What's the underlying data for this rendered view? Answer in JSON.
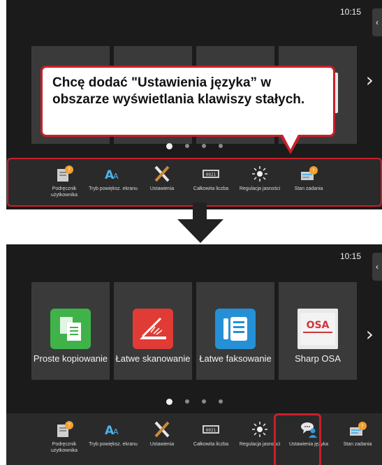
{
  "clock": "10:15",
  "callout_text": "Chcę dodać \"Ustawienia języka” w obszarze wyświetlania klawiszy stałych.",
  "tiles": [
    {
      "icon": "copy-icon",
      "label": "Proste kopiowanie",
      "color": "#3fb349"
    },
    {
      "icon": "scan-icon",
      "label": "Łatwe skanowanie",
      "color": "#e03b35"
    },
    {
      "icon": "fax-icon",
      "label": "Łatwe faksowanie",
      "color": "#2590d6"
    },
    {
      "icon": "sharp-osa-icon",
      "label": "Sharp OSA",
      "color": "#e9e9e9"
    }
  ],
  "bar_before": [
    {
      "icon": "user-manual-icon",
      "label": "Podręcznik użytkownika"
    },
    {
      "icon": "zoom-mode-icon",
      "label": "Tryb powiększ. ekranu"
    },
    {
      "icon": "settings-tools-icon",
      "label": "Ustawienia"
    },
    {
      "icon": "total-count-icon",
      "label": "Całkowita liczba"
    },
    {
      "icon": "brightness-icon",
      "label": "Regulacja jasności"
    },
    {
      "icon": "job-status-icon",
      "label": "Stan zadania"
    }
  ],
  "bar_after": [
    {
      "icon": "user-manual-icon",
      "label": "Podręcznik użytkownika"
    },
    {
      "icon": "zoom-mode-icon",
      "label": "Tryb powiększ. ekranu"
    },
    {
      "icon": "settings-tools-icon",
      "label": "Ustawienia"
    },
    {
      "icon": "total-count-icon",
      "label": "Całkowita liczba"
    },
    {
      "icon": "brightness-icon",
      "label": "Regulacja jasności"
    },
    {
      "icon": "language-settings-icon",
      "label": "Ustawienia języka"
    },
    {
      "icon": "job-status-icon",
      "label": "Stan zadania"
    }
  ],
  "accent_color": "#c8202a"
}
